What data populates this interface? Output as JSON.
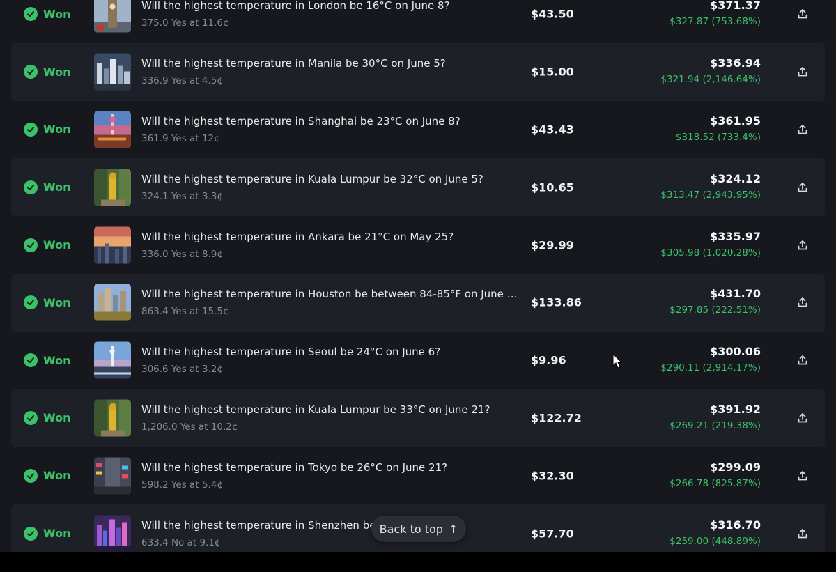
{
  "colors": {
    "won": "#3cc06a",
    "row_alt": "#1d2026",
    "background": "#16181d"
  },
  "positions": [
    {
      "status": "Won",
      "question": "Will the highest temperature in London be 16°C on June 8?",
      "shares": "375.0 Yes at 11.6¢",
      "cost": "$43.50",
      "value": "$371.37",
      "profit": "$327.87 (753.68%)",
      "thumb_icon": "london-big-ben-image"
    },
    {
      "status": "Won",
      "question": "Will the highest temperature in Manila be 30°C on June 5?",
      "shares": "336.9 Yes at 4.5¢",
      "cost": "$15.00",
      "value": "$336.94",
      "profit": "$321.94 (2,146.64%)",
      "thumb_icon": "manila-skyline-image"
    },
    {
      "status": "Won",
      "question": "Will the highest temperature in Shanghai be 23°C on June 8?",
      "shares": "361.9 Yes at 12¢",
      "cost": "$43.43",
      "value": "$361.95",
      "profit": "$318.52 (733.4%)",
      "thumb_icon": "shanghai-tower-image"
    },
    {
      "status": "Won",
      "question": "Will the highest temperature in Kuala Lumpur be 32°C on June 5?",
      "shares": "324.1 Yes at 3.3¢",
      "cost": "$10.65",
      "value": "$324.12",
      "profit": "$313.47 (2,943.95%)",
      "thumb_icon": "kuala-lumpur-statue-image"
    },
    {
      "status": "Won",
      "question": "Will the highest temperature in Ankara be 21°C on May 25?",
      "shares": "336.0 Yes at 8.9¢",
      "cost": "$29.99",
      "value": "$335.97",
      "profit": "$305.98 (1,020.28%)",
      "thumb_icon": "ankara-sunset-image"
    },
    {
      "status": "Won",
      "question": "Will the highest temperature in Houston be between 84-85°F on June …",
      "shares": "863.4 Yes at 15.5¢",
      "cost": "$133.86",
      "value": "$431.70",
      "profit": "$297.85 (222.51%)",
      "thumb_icon": "houston-skyline-image"
    },
    {
      "status": "Won",
      "question": "Will the highest temperature in Seoul be 24°C on June 6?",
      "shares": "306.6 Yes at 3.2¢",
      "cost": "$9.96",
      "value": "$300.06",
      "profit": "$290.11 (2,914.17%)",
      "thumb_icon": "seoul-tower-image"
    },
    {
      "status": "Won",
      "question": "Will the highest temperature in Kuala Lumpur be 33°C on June 21?",
      "shares": "1,206.0 Yes at 10.2¢",
      "cost": "$122.72",
      "value": "$391.92",
      "profit": "$269.21 (219.38%)",
      "thumb_icon": "kuala-lumpur-statue-image"
    },
    {
      "status": "Won",
      "question": "Will the highest temperature in Tokyo be 26°C on June 21?",
      "shares": "598.2 Yes at 5.4¢",
      "cost": "$32.30",
      "value": "$299.09",
      "profit": "$266.78 (825.87%)",
      "thumb_icon": "tokyo-street-image"
    },
    {
      "status": "Won",
      "question": "Will the highest temperature in Shenzhen be",
      "shares": "633.4 No at 9.1¢",
      "cost": "$57.70",
      "value": "$316.70",
      "profit": "$259.00 (448.89%)",
      "thumb_icon": "shenzhen-night-image"
    }
  ],
  "back_to_top": {
    "label": "Back to top",
    "arrow": "↑"
  }
}
